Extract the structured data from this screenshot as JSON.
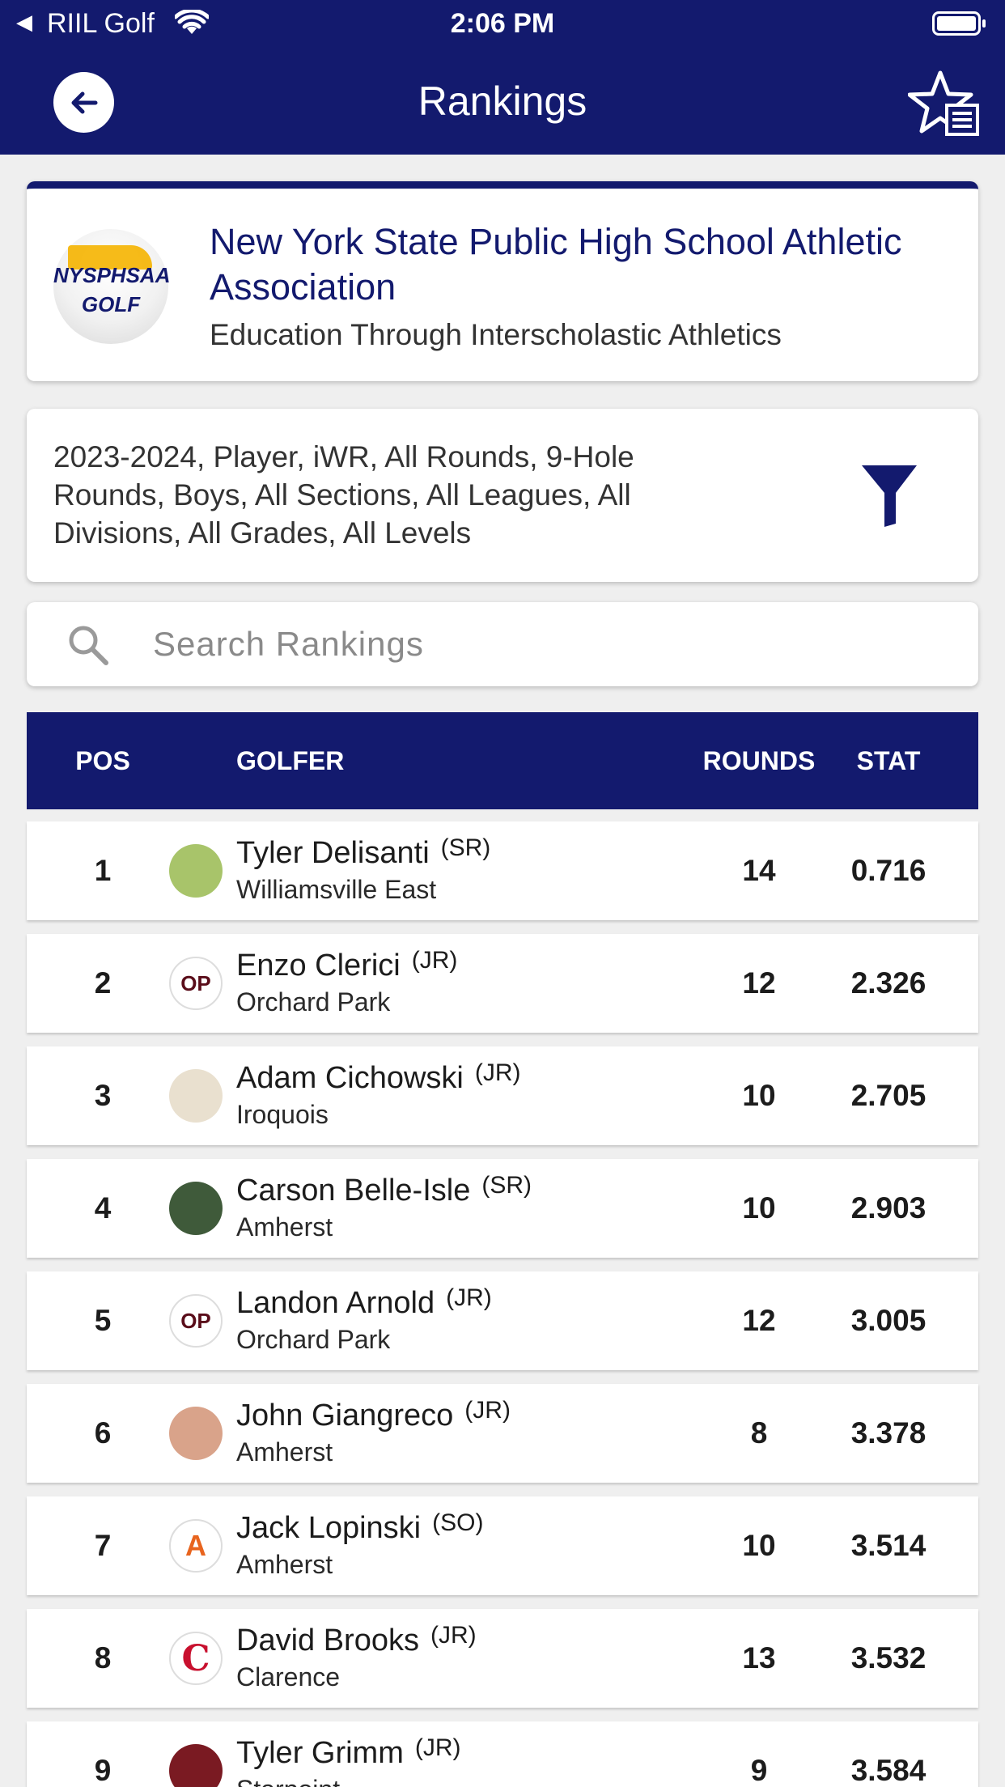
{
  "status_bar": {
    "back_app": "RIIL Golf",
    "time": "2:06 PM"
  },
  "header": {
    "title": "Rankings"
  },
  "organization": {
    "name": "New York State Public High School Athletic Association",
    "tagline": "Education Through Interscholastic Athletics",
    "logo_text_top": "NYSPHSAA",
    "logo_text_bottom": "GOLF"
  },
  "filters": {
    "summary": "2023-2024, Player, iWR, All Rounds, 9-Hole Rounds, Boys, All Sections, All Leagues, All Divisions, All Grades, All Levels"
  },
  "search": {
    "placeholder": "Search Rankings"
  },
  "table": {
    "columns": {
      "pos": "POS",
      "golfer": "GOLFER",
      "rounds": "ROUNDS",
      "stat": "STAT"
    },
    "rows": [
      {
        "pos": "1",
        "name": "Tyler Delisanti",
        "grade": "(SR)",
        "school": "Williamsville East",
        "rounds": "14",
        "stat": "0.716",
        "avatar_color": "#a8c46a",
        "avatar_text": ""
      },
      {
        "pos": "2",
        "name": "Enzo Clerici",
        "grade": "(JR)",
        "school": "Orchard Park",
        "rounds": "12",
        "stat": "2.326",
        "avatar_color": "#5a0d1a",
        "avatar_text": "OP"
      },
      {
        "pos": "3",
        "name": "Adam Cichowski",
        "grade": "(JR)",
        "school": "Iroquois",
        "rounds": "10",
        "stat": "2.705",
        "avatar_color": "#e9e0cf",
        "avatar_text": ""
      },
      {
        "pos": "4",
        "name": "Carson Belle-Isle",
        "grade": "(SR)",
        "school": "Amherst",
        "rounds": "10",
        "stat": "2.903",
        "avatar_color": "#3f5a3a",
        "avatar_text": ""
      },
      {
        "pos": "5",
        "name": "Landon Arnold",
        "grade": "(JR)",
        "school": "Orchard Park",
        "rounds": "12",
        "stat": "3.005",
        "avatar_color": "#5a0d1a",
        "avatar_text": "OP"
      },
      {
        "pos": "6",
        "name": "John Giangreco",
        "grade": "(JR)",
        "school": "Amherst",
        "rounds": "8",
        "stat": "3.378",
        "avatar_color": "#d9a38a",
        "avatar_text": ""
      },
      {
        "pos": "7",
        "name": "Jack Lopinski",
        "grade": "(SO)",
        "school": "Amherst",
        "rounds": "10",
        "stat": "3.514",
        "avatar_color": "#e8641e",
        "avatar_text": "A"
      },
      {
        "pos": "8",
        "name": "David Brooks",
        "grade": "(JR)",
        "school": "Clarence",
        "rounds": "13",
        "stat": "3.532",
        "avatar_color": "#ffffff",
        "avatar_text": "C"
      },
      {
        "pos": "9",
        "name": "Tyler Grimm",
        "grade": "(JR)",
        "school": "Starpoint",
        "rounds": "9",
        "stat": "3.584",
        "avatar_color": "#7a1a22",
        "avatar_text": ""
      }
    ]
  }
}
